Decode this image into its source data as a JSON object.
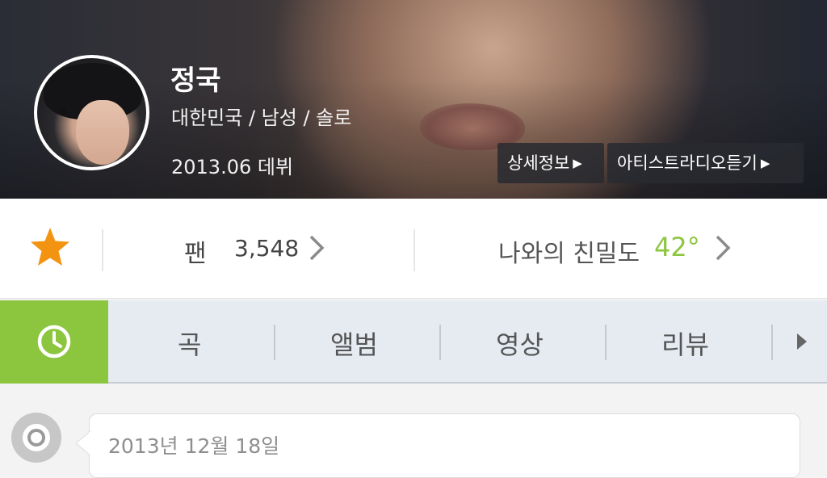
{
  "artist": {
    "name": "정국",
    "meta": "대한민국 / 남성 / 솔로",
    "debut": "2013.06 데뷔"
  },
  "header_buttons": {
    "detail_label": "상세정보",
    "radio_label": "아티스트라디오듣기",
    "arrow_glyph": "▶"
  },
  "stats": {
    "fan_label": "팬",
    "fan_count": "3,548",
    "intimacy_label": "나와의 친밀도",
    "intimacy_value": "42°"
  },
  "tabs": {
    "active_icon": "clock-icon",
    "items": [
      {
        "label": "곡"
      },
      {
        "label": "앨범"
      },
      {
        "label": "영상"
      },
      {
        "label": "리뷰"
      }
    ]
  },
  "timeline": {
    "date": "2013년 12월 18일"
  },
  "colors": {
    "accent_green": "#8cc63f",
    "star_orange": "#f29411",
    "tab_bg": "#e6ebf2"
  }
}
